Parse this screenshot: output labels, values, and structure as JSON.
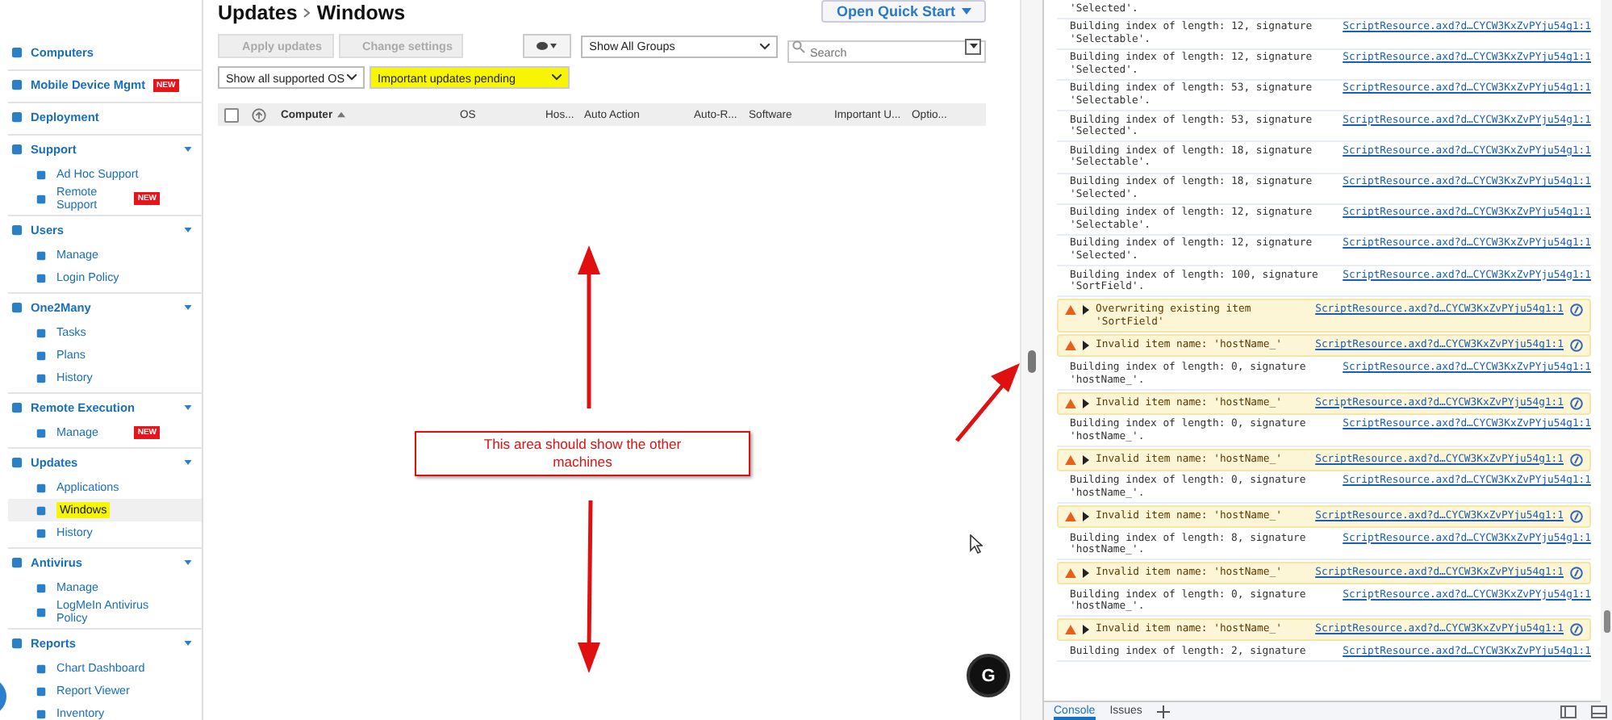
{
  "sidebar": {
    "groups": [
      {
        "label": "Computers"
      },
      {
        "label": "Mobile Device Mgmt",
        "badge": "NEW"
      },
      {
        "label": "Deployment"
      },
      {
        "label": "Support",
        "children": [
          {
            "label": "Ad Hoc Support",
            "selected": false
          },
          {
            "label": "Remote Support",
            "selected": false,
            "badge": "NEW"
          }
        ]
      },
      {
        "label": "Users",
        "children": [
          {
            "label": "Manage",
            "selected": false
          },
          {
            "label": "Login Policy",
            "selected": false
          }
        ]
      },
      {
        "label": "One2Many",
        "children": [
          {
            "label": "Tasks",
            "selected": false
          },
          {
            "label": "Plans",
            "selected": false
          },
          {
            "label": "History",
            "selected": false
          }
        ]
      },
      {
        "label": "Remote Execution",
        "children": [
          {
            "label": "Manage",
            "selected": false,
            "badge": "NEW"
          }
        ]
      },
      {
        "label": "Updates",
        "children": [
          {
            "label": "Applications",
            "selected": false
          },
          {
            "label": "Windows",
            "selected": true
          },
          {
            "label": "History",
            "selected": false
          }
        ]
      },
      {
        "label": "Antivirus",
        "children": [
          {
            "label": "Manage",
            "selected": false
          },
          {
            "label": "LogMeIn Antivirus Policy",
            "selected": false
          }
        ]
      },
      {
        "label": "Reports",
        "children": [
          {
            "label": "Chart Dashboard",
            "selected": false
          },
          {
            "label": "Report Viewer",
            "selected": false
          },
          {
            "label": "Inventory",
            "selected": false
          }
        ]
      }
    ]
  },
  "breadcrumb": [
    "Updates",
    "Windows"
  ],
  "quick_start_button": "Open Quick Start",
  "toolbar": {
    "buttons": [
      {
        "label": "Apply updates",
        "disabled": true
      },
      {
        "label": "Change settings",
        "disabled": true
      }
    ],
    "group_select": "Show All Groups",
    "search": {
      "placeholder": "Search"
    }
  },
  "filters": [
    {
      "value": "Show all supported OS",
      "highlighted": false
    },
    {
      "value": "Important updates pending",
      "highlighted": true
    }
  ],
  "table": {
    "select_all_checked": false,
    "columns": [
      {
        "label": "Computer",
        "sorted": true
      },
      {
        "label": "OS",
        "sorted": false
      },
      {
        "label": "Hos...",
        "sorted": false
      },
      {
        "label": "Auto Action",
        "sorted": false
      },
      {
        "label": "Auto-R...",
        "sorted": false
      },
      {
        "label": "Software",
        "sorted": false
      },
      {
        "label": "Important U...",
        "sorted": false
      },
      {
        "label": "Optio...",
        "sorted": false
      }
    ]
  },
  "annotation": {
    "text": "This area should show the other machines"
  },
  "assistant_button": "G",
  "devtools": {
    "entries": [
      {
        "kind": "continuation",
        "message": "'Selected'."
      },
      {
        "kind": "info",
        "message": "Building index of length: 12, signature 'Selectable'.",
        "source": "ScriptResource.axd?d…CYCW3KxZvPYju54g1:1"
      },
      {
        "kind": "info",
        "message": "Building index of length: 12, signature 'Selected'.",
        "source": "ScriptResource.axd?d…CYCW3KxZvPYju54g1:1"
      },
      {
        "kind": "info",
        "message": "Building index of length: 53, signature 'Selectable'.",
        "source": "ScriptResource.axd?d…CYCW3KxZvPYju54g1:1"
      },
      {
        "kind": "info",
        "message": "Building index of length: 53, signature 'Selected'.",
        "source": "ScriptResource.axd?d…CYCW3KxZvPYju54g1:1"
      },
      {
        "kind": "info",
        "message": "Building index of length: 18, signature 'Selectable'.",
        "source": "ScriptResource.axd?d…CYCW3KxZvPYju54g1:1"
      },
      {
        "kind": "info",
        "message": "Building index of length: 18, signature 'Selected'.",
        "source": "ScriptResource.axd?d…CYCW3KxZvPYju54g1:1"
      },
      {
        "kind": "info",
        "message": "Building index of length: 12, signature 'Selectable'.",
        "source": "ScriptResource.axd?d…CYCW3KxZvPYju54g1:1"
      },
      {
        "kind": "info",
        "message": "Building index of length: 12, signature 'Selected'.",
        "source": "ScriptResource.axd?d…CYCW3KxZvPYju54g1:1"
      },
      {
        "kind": "info",
        "message": "Building index of length: 100, signature 'SortField'.",
        "source": "ScriptResource.axd?d…CYCW3KxZvPYju54g1:1"
      },
      {
        "kind": "warning",
        "message": "Overwriting existing item 'SortField'",
        "source": "ScriptResource.axd?d…CYCW3KxZvPYju54g1:1"
      },
      {
        "kind": "warning",
        "message": "Invalid item name: 'hostName_'",
        "source": "ScriptResource.axd?d…CYCW3KxZvPYju54g1:1"
      },
      {
        "kind": "info",
        "message": "Building index of length: 0, signature 'hostName_'.",
        "source": "ScriptResource.axd?d…CYCW3KxZvPYju54g1:1"
      },
      {
        "kind": "warning",
        "message": "Invalid item name: 'hostName_'",
        "source": "ScriptResource.axd?d…CYCW3KxZvPYju54g1:1"
      },
      {
        "kind": "info",
        "message": "Building index of length: 0, signature 'hostName_'.",
        "source": "ScriptResource.axd?d…CYCW3KxZvPYju54g1:1"
      },
      {
        "kind": "warning",
        "message": "Invalid item name: 'hostName_'",
        "source": "ScriptResource.axd?d…CYCW3KxZvPYju54g1:1"
      },
      {
        "kind": "info",
        "message": "Building index of length: 0, signature 'hostName_'.",
        "source": "ScriptResource.axd?d…CYCW3KxZvPYju54g1:1"
      },
      {
        "kind": "warning",
        "message": "Invalid item name: 'hostName_'",
        "source": "ScriptResource.axd?d…CYCW3KxZvPYju54g1:1"
      },
      {
        "kind": "info",
        "message": "Building index of length: 8, signature 'hostName_'.",
        "source": "ScriptResource.axd?d…CYCW3KxZvPYju54g1:1"
      },
      {
        "kind": "warning",
        "message": "Invalid item name: 'hostName_'",
        "source": "ScriptResource.axd?d…CYCW3KxZvPYju54g1:1"
      },
      {
        "kind": "info",
        "message": "Building index of length: 0, signature 'hostName_'.",
        "source": "ScriptResource.axd?d…CYCW3KxZvPYju54g1:1"
      },
      {
        "kind": "warning",
        "message": "Invalid item name: 'hostName_'",
        "source": "ScriptResource.axd?d…CYCW3KxZvPYju54g1:1"
      },
      {
        "kind": "info",
        "message": "Building index of length: 2, signature",
        "source": "ScriptResource.axd?d…CYCW3KxZvPYju54g1:1"
      }
    ],
    "tabs": [
      {
        "label": "Console",
        "selected": true
      },
      {
        "label": "Issues",
        "selected": false
      }
    ]
  }
}
